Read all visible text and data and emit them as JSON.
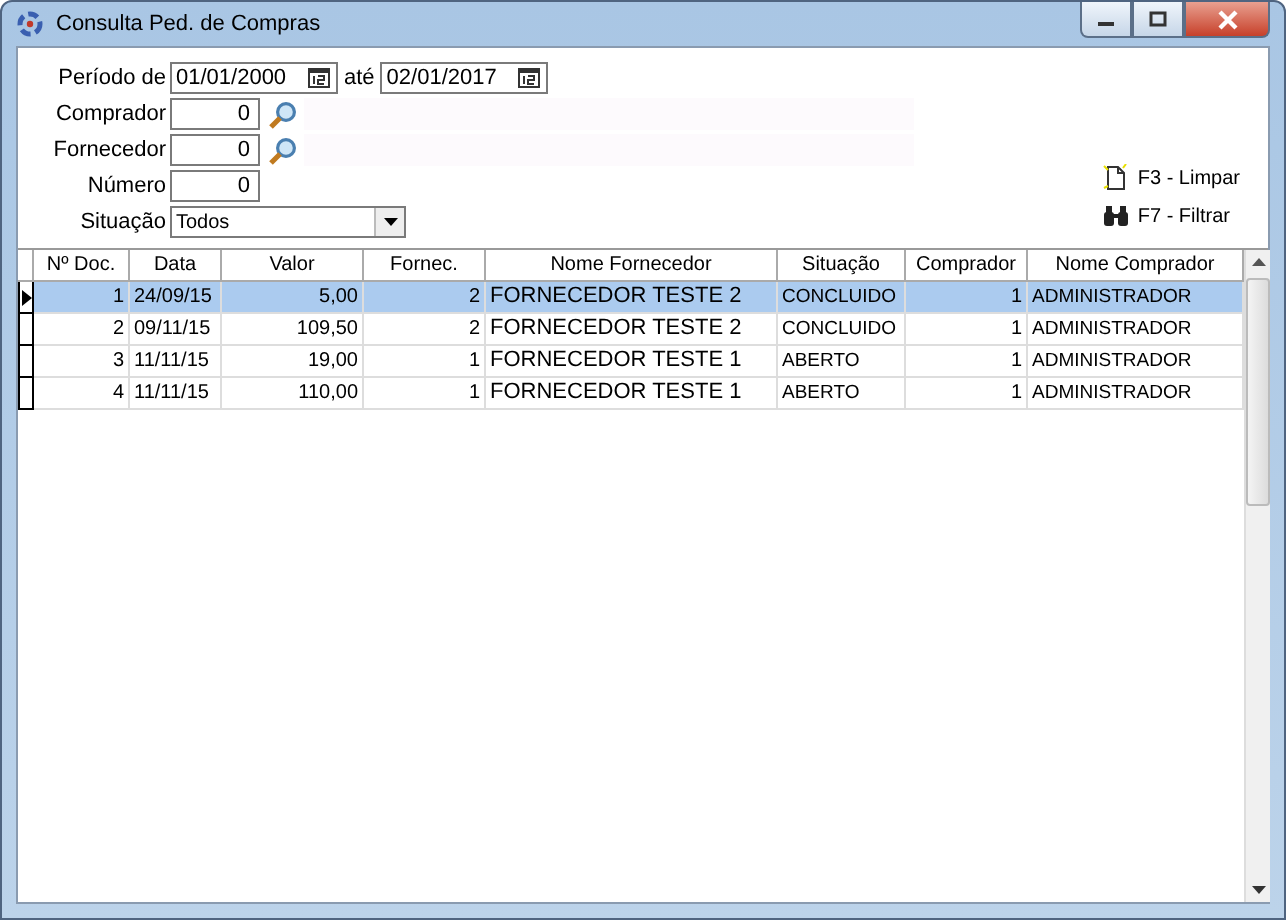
{
  "window": {
    "title": "Consulta Ped. de Compras"
  },
  "filters": {
    "period_label": "Período de",
    "date_from": "01/01/2000",
    "until_label": "até",
    "date_to": "02/01/2017",
    "buyer_label": "Comprador",
    "buyer": "0",
    "supplier_label": "Fornecedor",
    "supplier": "0",
    "number_label": "Número",
    "number": "0",
    "status_label": "Situação",
    "status": "Todos"
  },
  "actions": [
    {
      "kind": "clear",
      "label": "F3 - Limpar"
    },
    {
      "kind": "filter",
      "label": "F7 - Filtrar"
    }
  ],
  "table": {
    "columns": [
      "Nº Doc.",
      "Data",
      "Valor",
      "Fornec.",
      "Nome Fornecedor",
      "Situação",
      "Comprador",
      "Nome Comprador"
    ],
    "rows": [
      {
        "selected": true,
        "cells": [
          "1",
          "24/09/15",
          "5,00",
          "2",
          "FORNECEDOR TESTE 2",
          "CONCLUIDO",
          "1",
          "ADMINISTRADOR"
        ]
      },
      {
        "selected": false,
        "cells": [
          "2",
          "09/11/15",
          "109,50",
          "2",
          "FORNECEDOR TESTE 2",
          "CONCLUIDO",
          "1",
          "ADMINISTRADOR"
        ]
      },
      {
        "selected": false,
        "cells": [
          "3",
          "11/11/15",
          "19,00",
          "1",
          "FORNECEDOR TESTE 1",
          "ABERTO",
          "1",
          "ADMINISTRADOR"
        ]
      },
      {
        "selected": false,
        "cells": [
          "4",
          "11/11/15",
          "110,00",
          "1",
          "FORNECEDOR TESTE 1",
          "ABERTO",
          "1",
          "ADMINISTRADOR"
        ]
      }
    ]
  }
}
